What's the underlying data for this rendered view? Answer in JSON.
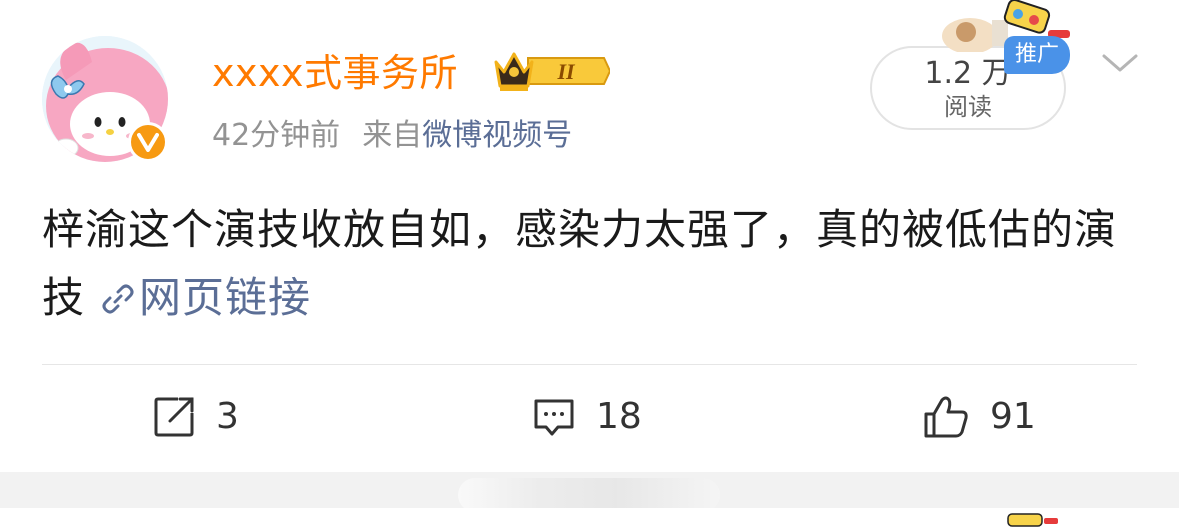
{
  "post": {
    "username": "xxxx式事务所",
    "member_badge_level": "II",
    "time": "42分钟前",
    "source_prefix": "来自",
    "source_name": "微博视频号",
    "read_count": "1.2 万",
    "read_label": "阅读",
    "promo_label": "推广",
    "content_text": "梓渝这个演技收放自如，感染力太强了，真的被低估的演技",
    "link_label": "网页链接",
    "actions": {
      "repost_count": "3",
      "comment_count": "18",
      "like_count": "91"
    }
  },
  "colors": {
    "username": "#ff7a00",
    "link": "#5b6e96",
    "meta": "#939393",
    "verified_badge": "#f79a12",
    "promo_badge": "#4a92e8"
  },
  "icons": [
    "avatar-melody",
    "verified-v-icon",
    "crown-level-icon",
    "chevron-down-icon",
    "link-icon",
    "repost-icon",
    "comment-icon",
    "like-icon"
  ]
}
